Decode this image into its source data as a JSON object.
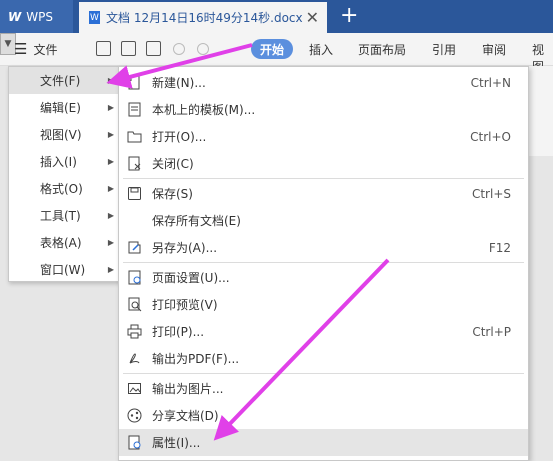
{
  "app": {
    "name": "WPS",
    "doc_tab_title": "文档 12月14日16时49分14秒.docx",
    "close_glyph": "✕",
    "new_tab_glyph": "+"
  },
  "toolbar": {
    "file_menu_label": "文件",
    "start_tab": "开始",
    "tabs": [
      "插入",
      "页面布局",
      "引用",
      "审阅",
      "视图"
    ]
  },
  "left_menu": {
    "items": [
      {
        "label": "文件(F)",
        "active": true
      },
      {
        "label": "编辑(E)"
      },
      {
        "label": "视图(V)"
      },
      {
        "label": "插入(I)"
      },
      {
        "label": "格式(O)"
      },
      {
        "label": "工具(T)"
      },
      {
        "label": "表格(A)"
      },
      {
        "label": "窗口(W)"
      }
    ]
  },
  "file_submenu": {
    "items": [
      {
        "label": "新建(N)...",
        "shortcut": "Ctrl+N",
        "icon": "new-doc-icon"
      },
      {
        "label": "本机上的模板(M)...",
        "shortcut": "",
        "icon": "template-icon"
      },
      {
        "label": "打开(O)...",
        "shortcut": "Ctrl+O",
        "icon": "folder-icon"
      },
      {
        "label": "关闭(C)",
        "shortcut": "",
        "icon": "close-doc-icon"
      },
      {
        "label": "保存(S)",
        "shortcut": "Ctrl+S",
        "icon": "save-icon"
      },
      {
        "label": "保存所有文档(E)",
        "shortcut": "",
        "icon": ""
      },
      {
        "label": "另存为(A)...",
        "shortcut": "F12",
        "icon": "save-as-icon"
      },
      {
        "label": "页面设置(U)...",
        "shortcut": "",
        "icon": "page-setup-icon"
      },
      {
        "label": "打印预览(V)",
        "shortcut": "",
        "icon": "print-preview-icon"
      },
      {
        "label": "打印(P)...",
        "shortcut": "Ctrl+P",
        "icon": "printer-icon"
      },
      {
        "label": "输出为PDF(F)...",
        "shortcut": "",
        "icon": "pdf-export-icon"
      },
      {
        "label": "输出为图片...",
        "shortcut": "",
        "icon": "image-export-icon"
      },
      {
        "label": "分享文档(D)",
        "shortcut": "",
        "icon": "share-icon"
      },
      {
        "label": "属性(I)...",
        "shortcut": "",
        "icon": "properties-icon",
        "highlight": true
      }
    ]
  },
  "annotations": {
    "arrow_color": "#e040e8"
  }
}
